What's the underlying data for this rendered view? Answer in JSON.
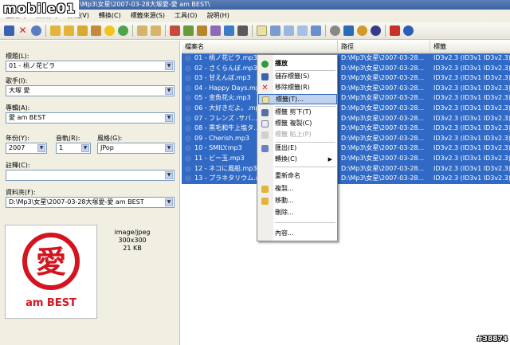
{
  "window": {
    "title": "Mp3tag v2.41 - D:\\Mp3\\女星\\2007-03-28大塚愛-愛 am BEST\\",
    "watermark": "mobile01"
  },
  "menubar": {
    "items": [
      "檔案(F)",
      "編輯(E)",
      "檢視(V)",
      "轉換(C)",
      "標籤來源(S)",
      "工具(O)",
      "說明(H)"
    ]
  },
  "fields": {
    "title_label": "標題(L):",
    "title_value": "01 - 桃ノ花ビラ",
    "artist_label": "歌手(I):",
    "artist_value": "大塚 愛",
    "album_label": "專輯(A):",
    "album_value": "愛 am BEST",
    "year_label": "年份(Y):",
    "year_value": "2007",
    "track_label": "音軌(R):",
    "track_value": "1",
    "genre_label": "風格(G):",
    "genre_value": "JPop",
    "comment_label": "註釋(C):",
    "comment_value": "",
    "folder_label": "資料夾(F):",
    "folder_value": "D:\\Mp3\\女星\\2007-03-28大塚愛-愛 am BEST"
  },
  "cover": {
    "mime": "image/jpeg",
    "size": "300x300",
    "filesize": "21 KB",
    "art_text": "am BEST",
    "art_char": "愛"
  },
  "columns": [
    "檔案名",
    "路徑",
    "標籤"
  ],
  "rows": [
    {
      "file": "01 - 桃ノ花ビラ.mp3",
      "path": "D:\\Mp3\\女星\\2007-03-28...",
      "tag": "ID3v2.3 (ID3v1 ID3v2.3)",
      "selected": true
    },
    {
      "file": "02 - さくらんぼ.mp3",
      "path": "D:\\Mp3\\女星\\2007-03-28...",
      "tag": "ID3v2.3 (ID3v1 ID3v2.3)",
      "selected": true
    },
    {
      "file": "03 - 甘えんぼ.mp3",
      "path": "D:\\Mp3\\女星\\2007-03-28...",
      "tag": "ID3v2.3 (ID3v1 ID3v2.3)",
      "selected": true
    },
    {
      "file": "04 - Happy Days.mp3",
      "path": "D:\\Mp3\\女星\\2007-03-28...",
      "tag": "ID3v2.3 (ID3v1 ID3v2.3)",
      "selected": true
    },
    {
      "file": "05 - 金魚花火.mp3",
      "path": "D:\\Mp3\\女星\\2007-03-28...",
      "tag": "ID3v2.3 (ID3v1 ID3v2.3)",
      "selected": true
    },
    {
      "file": "06 - 大好きだよ。.mp3",
      "path": "D:\\Mp3\\女星\\2007-03-28...",
      "tag": "ID3v2.3 (ID3v1 ID3v2.3)",
      "selected": true
    },
    {
      "file": "07 - フレンズ -サバ...",
      "path": "D:\\Mp3\\女星\\2007-03-28...",
      "tag": "ID3v2.3 (ID3v1 ID3v2.3)",
      "selected": true
    },
    {
      "file": "08 - 黒毛和牛上塩タ...",
      "path": "D:\\Mp3\\女星\\2007-03-28...",
      "tag": "ID3v2.3 (ID3v1 ID3v2.3)",
      "selected": true
    },
    {
      "file": "09 - Cherish.mp3",
      "path": "D:\\Mp3\\女星\\2007-03-28...",
      "tag": "ID3v2.3 (ID3v1 ID3v2.3)",
      "selected": true
    },
    {
      "file": "10 - SMILY.mp3",
      "path": "D:\\Mp3\\女星\\2007-03-28...",
      "tag": "ID3v2.3 (ID3v1 ID3v2.3)",
      "selected": true
    },
    {
      "file": "11 - ビー玉.mp3",
      "path": "D:\\Mp3\\女星\\2007-03-28...",
      "tag": "ID3v2.3 (ID3v1 ID3v2.3)",
      "selected": true
    },
    {
      "file": "12 - ネコに風船.mp3",
      "path": "D:\\Mp3\\女星\\2007-03-28...",
      "tag": "ID3v2.3 (ID3v1 ID3v2.3)",
      "selected": true
    },
    {
      "file": "13 - プラネタリウム.mp3",
      "path": "D:\\Mp3\\女星\\2007-03-28...",
      "tag": "ID3v2.3 (ID3v1 ID3v2.3)",
      "selected": true
    }
  ],
  "context_menu": {
    "play": "播放",
    "save_tag": "儲存標籤(S)",
    "remove_tag": "移除標籤(R)",
    "tag": "標籤(T)...",
    "cut_tag": "標籤 剪下(T)",
    "copy_tag": "標籤 複製(C)",
    "paste_tag": "標籤 貼上(P)",
    "export": "匯出(E)",
    "convert": "轉換(C)",
    "rename": "重新命名",
    "copy": "複製...",
    "move": "移動...",
    "delete": "刪除...",
    "content": "內容..."
  },
  "corner_watermark": "#38874",
  "colors": {
    "selection": "#316ac5",
    "menu_highlight": "#c1d2ee",
    "art_red": "#d4141f"
  }
}
